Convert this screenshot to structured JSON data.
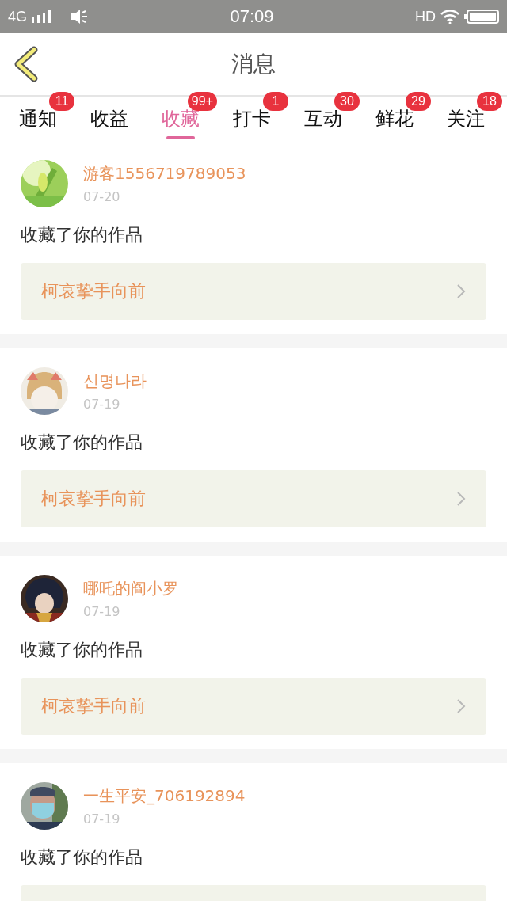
{
  "status_bar": {
    "network": "4G",
    "time": "07:09",
    "hd": "HD"
  },
  "header": {
    "title": "消息"
  },
  "tabs": [
    {
      "label": "通知",
      "badge": "11",
      "selected": false
    },
    {
      "label": "收益",
      "selected": false
    },
    {
      "label": "收藏",
      "badge": "99+",
      "selected": true
    },
    {
      "label": "打卡",
      "badge": "1",
      "selected": false
    },
    {
      "label": "互动",
      "badge": "30",
      "selected": false
    },
    {
      "label": "鲜花",
      "badge": "29",
      "selected": false
    },
    {
      "label": "关注",
      "badge": "18",
      "selected": false
    }
  ],
  "messages": [
    {
      "user": "游客1556719789053",
      "date": "07-20",
      "text": "收藏了你的作品",
      "work": "柯哀挚手向前"
    },
    {
      "user": "신명나라",
      "date": "07-19",
      "text": "收藏了你的作品",
      "work": "柯哀挚手向前"
    },
    {
      "user": "哪吒的阎小罗",
      "date": "07-19",
      "text": "收藏了你的作品",
      "work": "柯哀挚手向前"
    },
    {
      "user": "一生平安_706192894",
      "date": "07-19",
      "text": "收藏了你的作品"
    }
  ]
}
